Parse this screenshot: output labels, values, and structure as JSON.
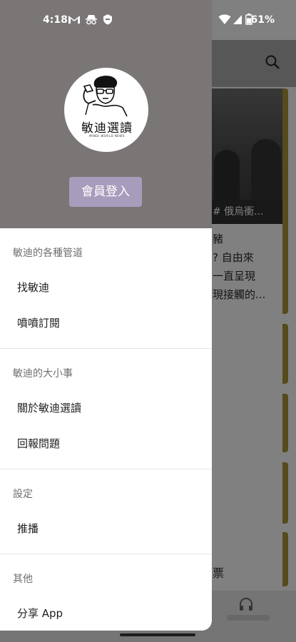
{
  "status_bar": {
    "time": "4:18",
    "battery": "61%",
    "icons": [
      "gmail-icon",
      "incognito-icon",
      "shield-icon",
      "wifi-icon",
      "signal-icon",
      "battery-icon"
    ]
  },
  "background_app": {
    "card_tag": "# 俄烏衝...",
    "card_lines": [
      "豬",
      "? 自由來",
      "一直呈現",
      "現接觸的..."
    ],
    "card_line2": "票",
    "accent_color": "#8a7a2c"
  },
  "drawer": {
    "logo": {
      "title": "敏迪選讀",
      "subtitle": "MINDI WORLD NEWS"
    },
    "login_button": "會員登入",
    "sections": [
      {
        "title": "敏迪的各種管道",
        "items": [
          "找敏迪",
          "噴噴訂閱"
        ]
      },
      {
        "title": "敏迪的大小事",
        "items": [
          "關於敏迪選讀",
          "回報問題"
        ]
      },
      {
        "title": "設定",
        "items": [
          "推播"
        ]
      },
      {
        "title": "其他",
        "items": [
          "分享 App"
        ]
      }
    ],
    "header_color": "#7b7676",
    "button_color": "#a79cbc"
  }
}
